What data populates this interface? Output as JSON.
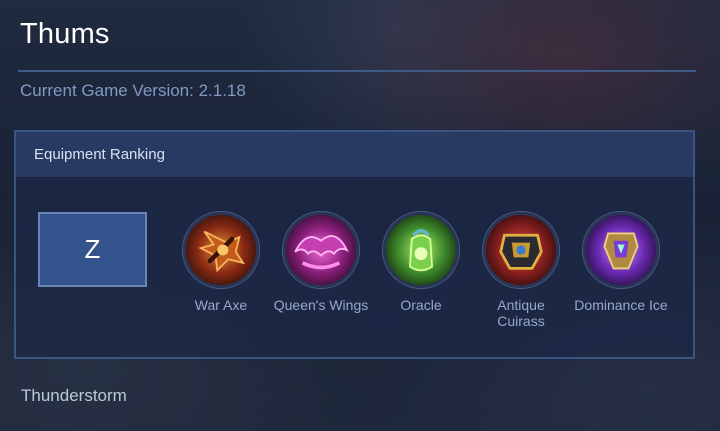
{
  "hero": {
    "name": "Thums"
  },
  "version": {
    "text": "Current Game Version: 2.1.18"
  },
  "equipment_panel": {
    "title": "Equipment Ranking",
    "rank": "Z",
    "items": [
      {
        "label": "War Axe",
        "icon": "war-axe-icon"
      },
      {
        "label": "Queen's Wings",
        "icon": "queens-wings-icon"
      },
      {
        "label": "Oracle",
        "icon": "oracle-icon"
      },
      {
        "label": "Antique\nCuirass",
        "icon": "antique-cuirass-icon"
      },
      {
        "label": "Dominance Ice",
        "icon": "dominance-ice-icon"
      }
    ]
  },
  "next_section": {
    "title": "Thunderstorm"
  },
  "colors": {
    "accent": "#34538c",
    "panel_border": "#3a5584",
    "version_text": "#7e9bc2"
  }
}
